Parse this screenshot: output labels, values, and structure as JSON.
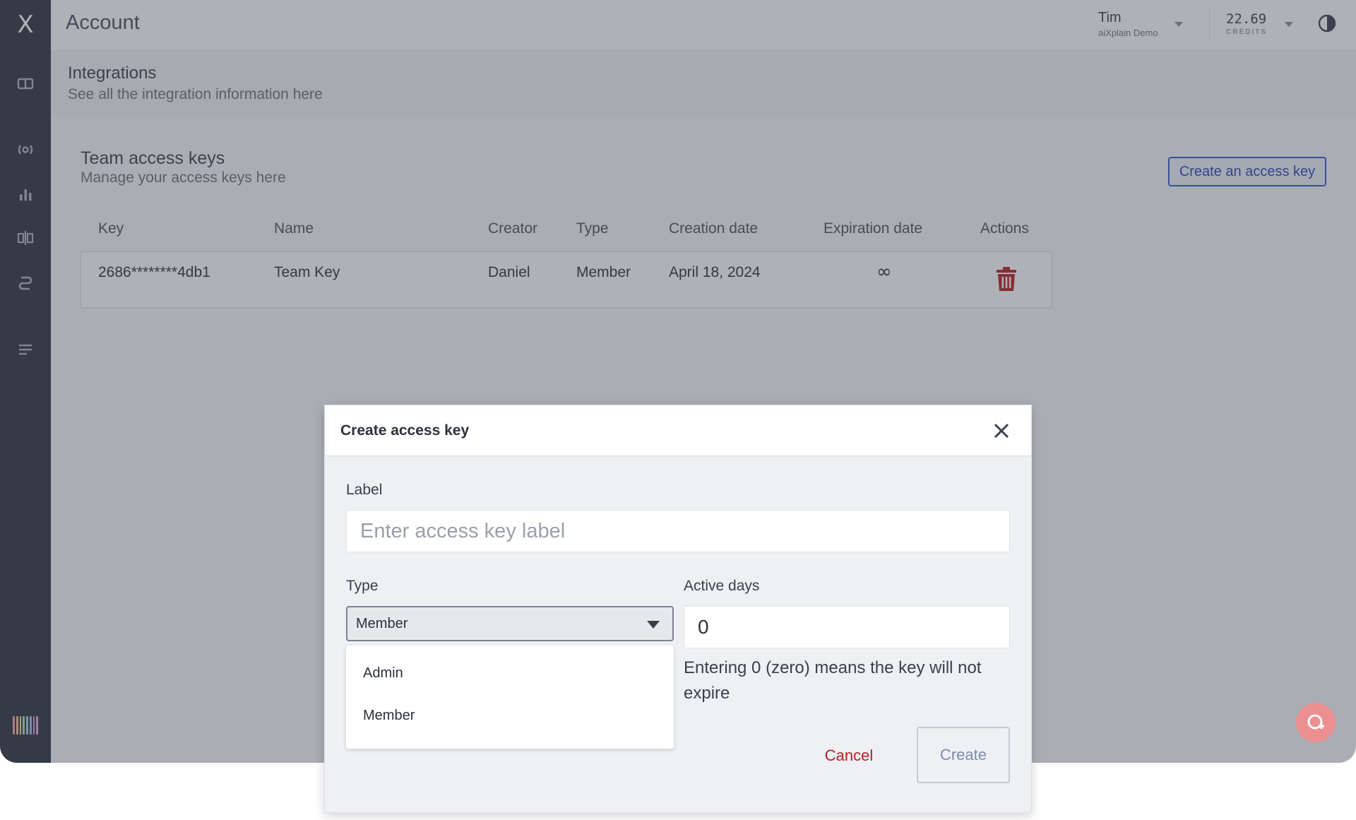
{
  "app": {
    "logo": "X",
    "page_title": "Account"
  },
  "user": {
    "name": "Tim",
    "org": "aiXplain Demo"
  },
  "credits": {
    "amount": "22.69",
    "label": "CREDITS"
  },
  "sidebar": {
    "icons": [
      "dashboard-icon",
      "broadcast-icon",
      "bar-chart-icon",
      "compare-icon",
      "models-icon",
      "list-icon"
    ]
  },
  "page": {
    "title": "Integrations",
    "subtitle": "See all the integration information here"
  },
  "section": {
    "title": "Team access keys",
    "subtitle": "Manage your access keys here",
    "create_button": "Create an access key"
  },
  "table": {
    "headers": [
      "Key",
      "Name",
      "Creator",
      "Type",
      "Creation date",
      "Expiration date",
      "Actions"
    ],
    "rows": [
      {
        "key": "2686********4db1",
        "name": "Team Key",
        "creator": "Daniel",
        "type": "Member",
        "creation_date": "April 18, 2024",
        "expiration": "∞"
      }
    ]
  },
  "modal": {
    "title": "Create access key",
    "label_field": {
      "label": "Label",
      "placeholder": "Enter access key label",
      "value": ""
    },
    "type_field": {
      "label": "Type",
      "selected": "Member",
      "options": [
        "Admin",
        "Member"
      ]
    },
    "days_field": {
      "label": "Active days",
      "value": "0",
      "hint": "Entering 0 (zero) means the key will not expire"
    },
    "cancel": "Cancel",
    "create": "Create"
  },
  "colors": {
    "accent": "#3b56c9",
    "danger": "#b42124",
    "sidebar": "#2f3341"
  }
}
